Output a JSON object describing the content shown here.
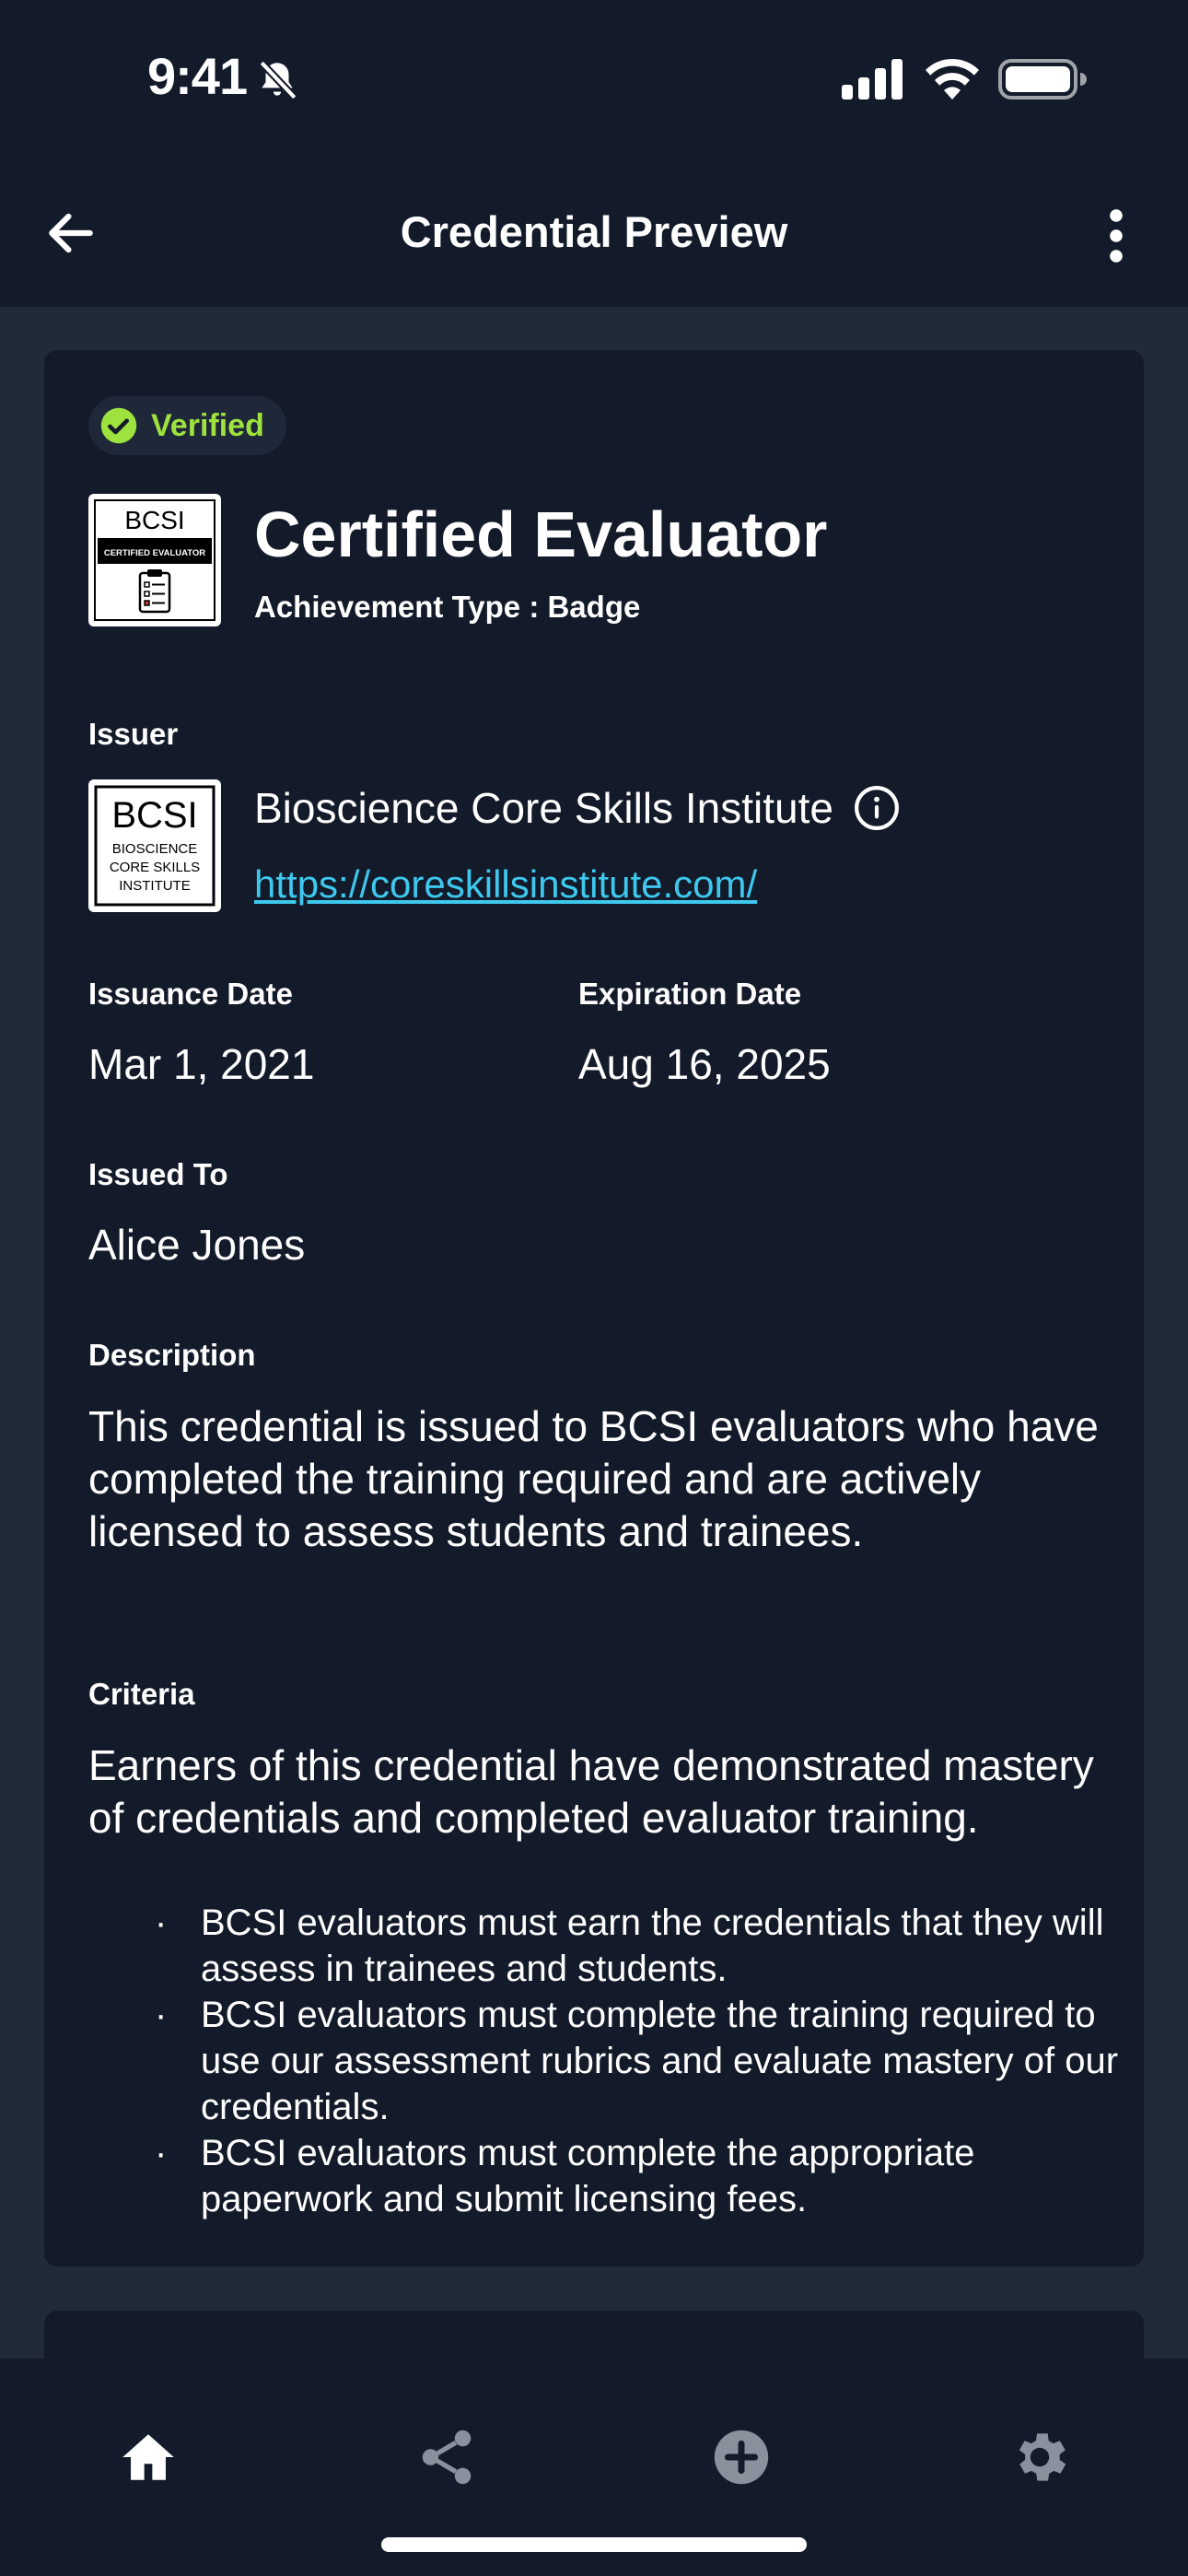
{
  "status_bar": {
    "time": "9:41"
  },
  "header": {
    "title": "Credential Preview"
  },
  "credential": {
    "verified_label": "Verified",
    "title": "Certified Evaluator",
    "achievement_type": "Achievement Type : Badge",
    "badge_logo": {
      "top_text": "BCSI",
      "band_text": "CERTIFIED EVALUATOR"
    },
    "issuer_label": "Issuer",
    "issuer_logo": {
      "line1": "BCSI",
      "line2": "BIOSCIENCE",
      "line3": "CORE SKILLS",
      "line4": "INSTITUTE"
    },
    "issuer_name": "Bioscience Core Skills Institute",
    "issuer_url": "https://coreskillsinstitute.com/",
    "issuance_label": "Issuance Date",
    "issuance_date": "Mar 1, 2021",
    "expiration_label": "Expiration Date",
    "expiration_date": "Aug 16, 2025",
    "issued_to_label": "Issued To",
    "issued_to": "Alice Jones",
    "description_label": "Description",
    "description": "This credential is issued to BCSI evaluators who have completed the training required and are actively licensed to assess students and trainees.",
    "criteria_label": "Criteria",
    "criteria_intro": "Earners of this credential have demonstrated mastery of credentials and completed evaluator training.",
    "criteria_items": [
      "BCSI evaluators must earn the credentials that they will assess in trainees and students.",
      "BCSI evaluators must complete the training required to use our assessment rubrics and evaluate mastery of our credentials.",
      "BCSI evaluators must complete the appropriate paperwork and submit licensing fees."
    ]
  },
  "bottom_nav": {
    "items": [
      {
        "icon": "home-icon",
        "active": true
      },
      {
        "icon": "share-icon",
        "active": false
      },
      {
        "icon": "add-circle-icon",
        "active": false
      },
      {
        "icon": "gear-icon",
        "active": false
      }
    ]
  },
  "colors": {
    "background": "#212a38",
    "surface": "#131a29",
    "verified": "#9de23e",
    "link": "#3ec8ee",
    "inactive_icon": "#8a919d"
  }
}
